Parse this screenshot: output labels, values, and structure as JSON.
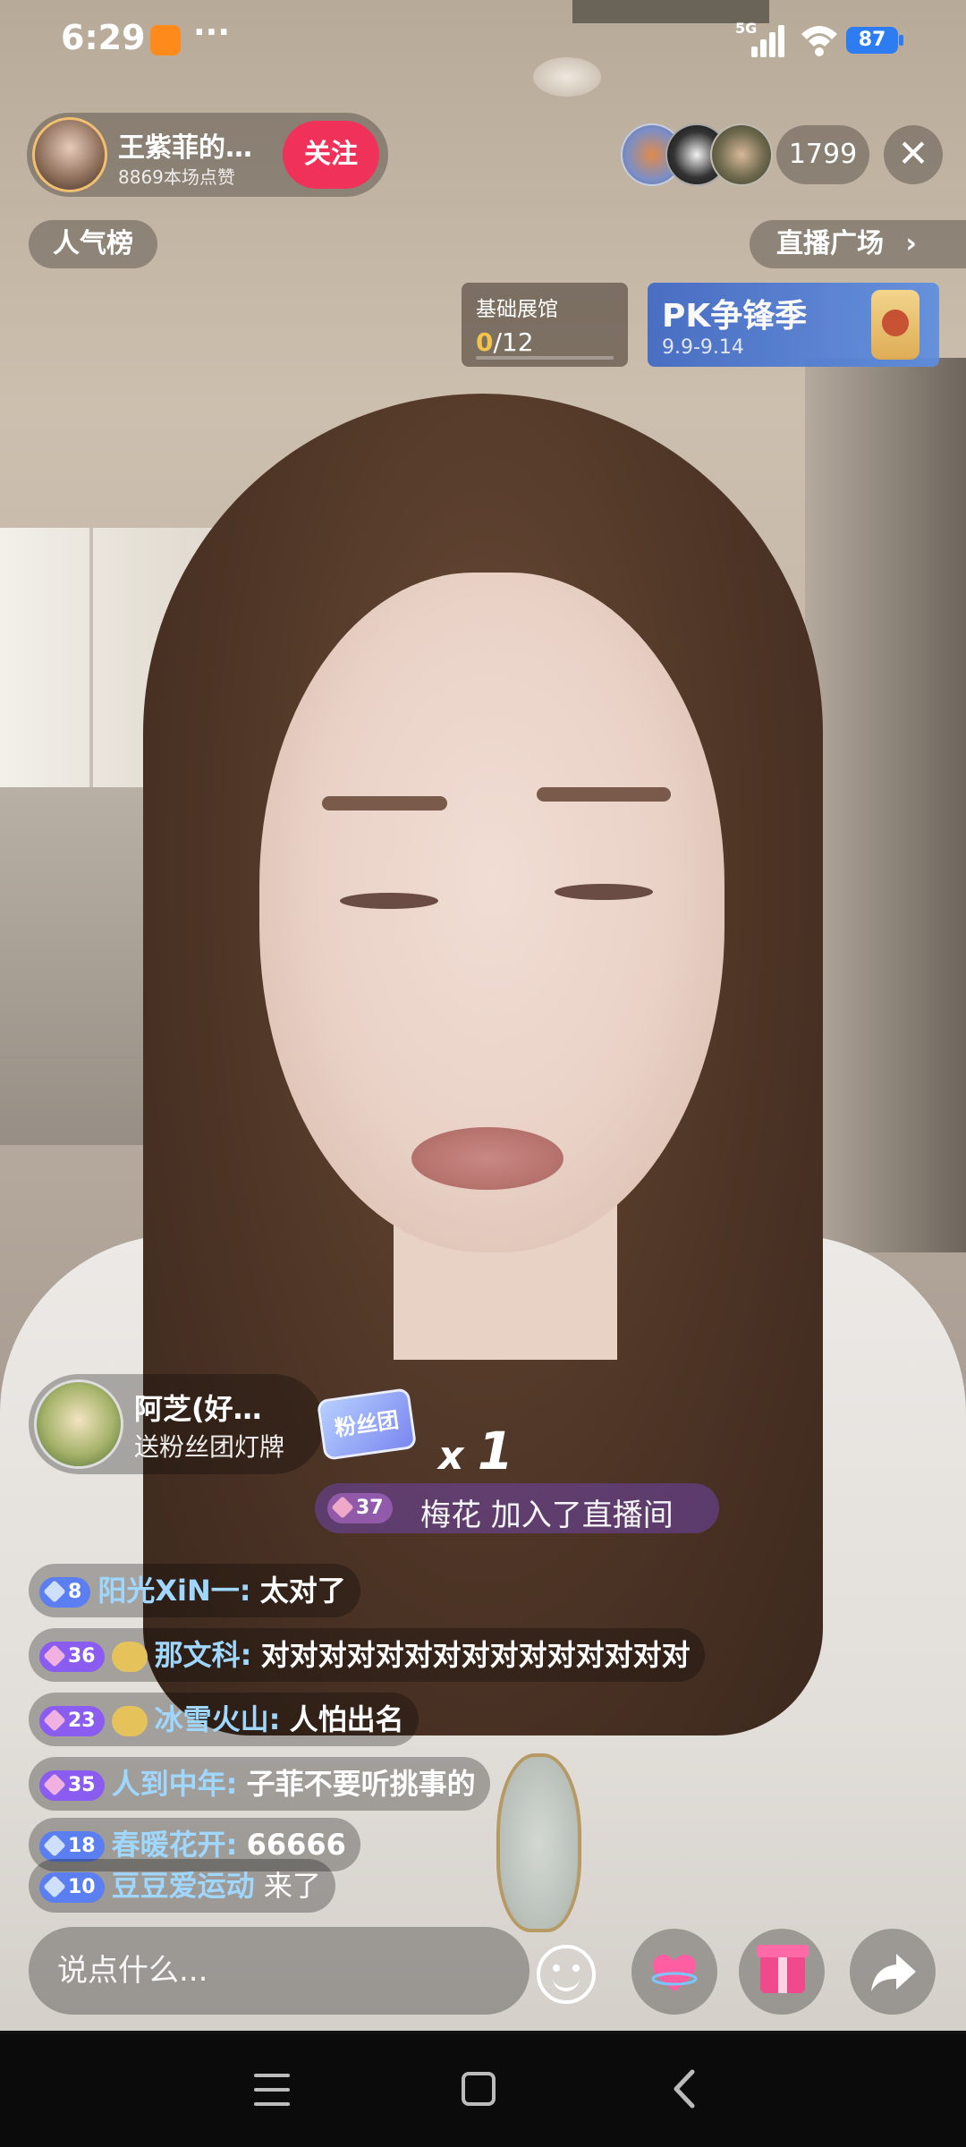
{
  "status_bar": {
    "time": "6:29",
    "dots": "···",
    "network": "5G",
    "battery": "87"
  },
  "host": {
    "name": "王紫菲的…",
    "likes": "8869本场点赞",
    "follow_label": "关注"
  },
  "viewers": {
    "count": "1799"
  },
  "close_glyph": "✕",
  "popularity_label": "人气榜",
  "plaza_label": "直播广场",
  "plaza_chevron": "›",
  "hall_card": {
    "title": "基础展馆",
    "progress_current": "0",
    "progress_total": "/12",
    "progress_fraction": 0
  },
  "pk_card": {
    "title": "PK争锋季",
    "dates": "9.9-9.14"
  },
  "gift": {
    "user": "阿芝(好…",
    "desc": "送粉丝团灯牌",
    "badge": "粉丝团",
    "count_prefix": "x",
    "count": "1"
  },
  "join": {
    "level": "37",
    "text": "梅花 加入了直播间"
  },
  "chat": [
    {
      "level": "8",
      "user": "阳光XiN一:",
      "msg": "太对了"
    },
    {
      "level": "36",
      "user": "那文科:",
      "msg": "对对对对对对对对对对对对对对对"
    },
    {
      "level": "23",
      "user": "冰雪火山:",
      "msg": "人怕出名"
    },
    {
      "level": "35",
      "user": "人到中年:",
      "msg": "子菲不要听挑事的"
    },
    {
      "level": "18",
      "user": "春暖花开:",
      "msg": "66666"
    },
    {
      "level": "10",
      "user": "豆豆爱运动",
      "msg": "来了"
    }
  ],
  "input": {
    "placeholder": "说点什么..."
  },
  "icons": {
    "emoji": "emoji-icon",
    "like": "heart-icon",
    "gift": "gift-icon",
    "share": "share-icon"
  },
  "colors": {
    "follow": "#f0325a",
    "pk_card": "#4a76d6",
    "username": "#9fd7ff"
  }
}
